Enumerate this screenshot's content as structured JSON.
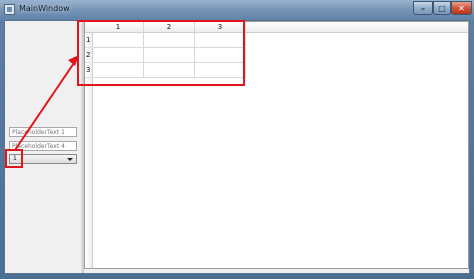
{
  "window": {
    "title": "MainWindow",
    "controls": {
      "minimize": "–",
      "maximize": "□",
      "close": "✕"
    }
  },
  "left_panel": {
    "input1": {
      "placeholder": "PlaceholderText 1"
    },
    "input2": {
      "placeholder": "PlaceholderText 4"
    },
    "combo": {
      "value": "1"
    }
  },
  "table": {
    "columns": [
      "1",
      "2",
      "3"
    ],
    "rows": [
      "1",
      "2",
      "3"
    ]
  },
  "annotation": {
    "color": "#e0161c"
  }
}
